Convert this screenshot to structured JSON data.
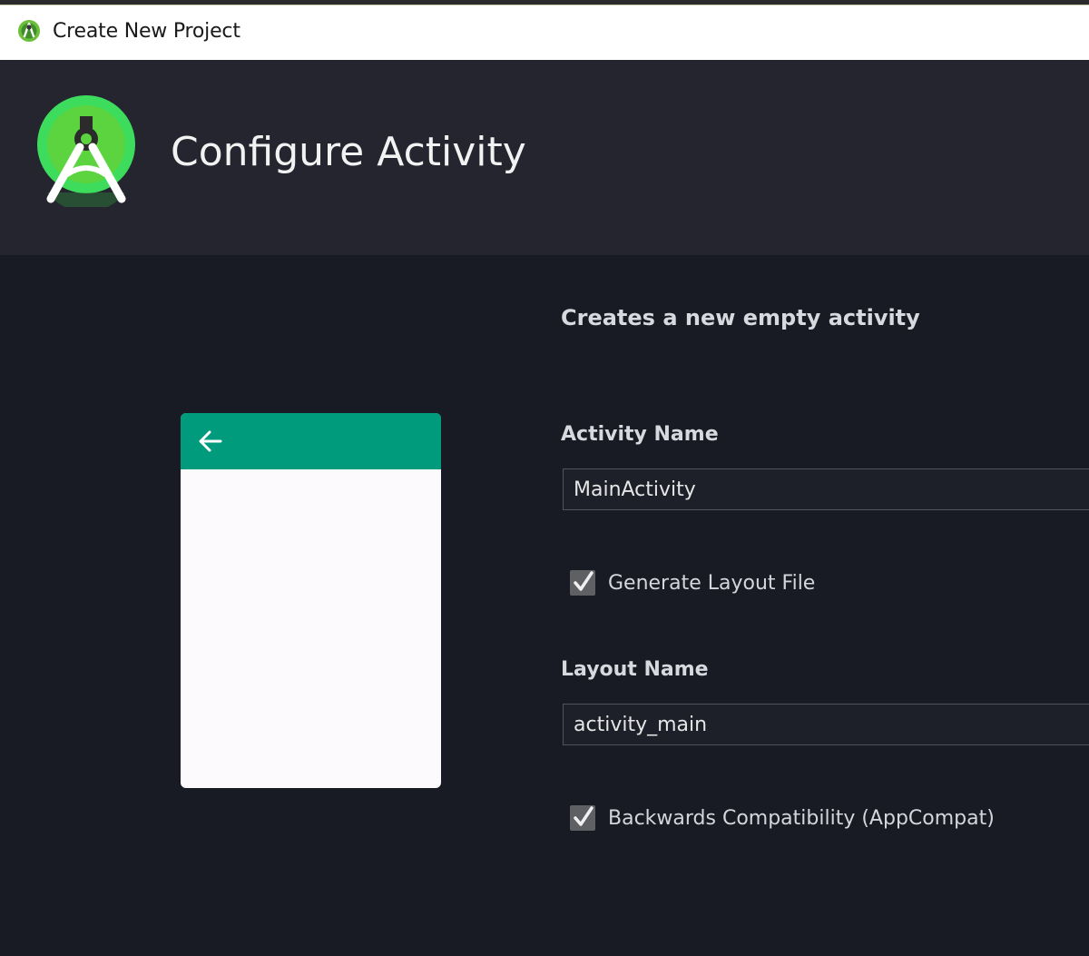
{
  "window": {
    "title": "Create New Project",
    "icon": "android-studio-icon"
  },
  "banner": {
    "logo": "android-studio-logo",
    "heading": "Configure Activity"
  },
  "main": {
    "subtitle": "Creates a new empty activity",
    "preview": {
      "toolbar_icon": "arrow-left-icon",
      "toolbar_color": "#009a7c"
    },
    "activity_name": {
      "label": "Activity Name",
      "value": "MainActivity"
    },
    "generate_layout": {
      "label": "Generate Layout File",
      "checked": true
    },
    "layout_name": {
      "label": "Layout Name",
      "value": "activity_main"
    },
    "backwards_compat": {
      "label": "Backwards Compatibility (AppCompat)",
      "checked": true
    }
  },
  "colors": {
    "accent": "#3ddc84",
    "background": "#181b24",
    "banner": "#252530"
  }
}
